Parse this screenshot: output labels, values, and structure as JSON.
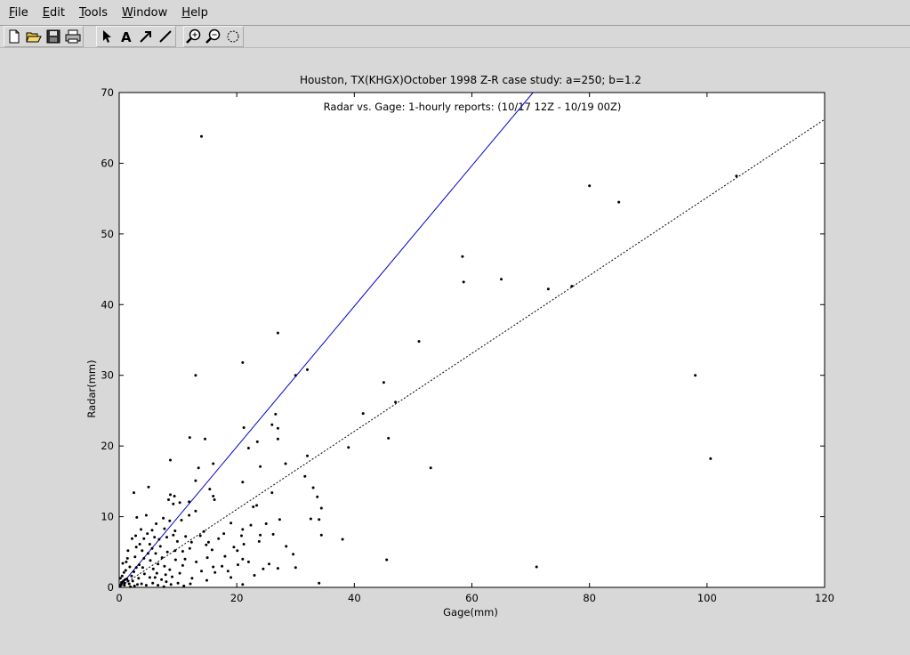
{
  "menu": [
    {
      "label": "File",
      "underline": "F",
      "rest": "ile"
    },
    {
      "label": "Edit",
      "underline": "E",
      "rest": "dit"
    },
    {
      "label": "Tools",
      "underline": "T",
      "rest": "ools"
    },
    {
      "label": "Window",
      "underline": "W",
      "rest": "indow"
    },
    {
      "label": "Help",
      "underline": "H",
      "rest": "elp"
    }
  ],
  "toolbar": {
    "file_group": [
      "new-file-icon",
      "open-folder-icon",
      "save-disk-icon",
      "print-icon"
    ],
    "edit_group": [
      "select-arrow-icon",
      "text-tool-icon",
      "arrow-tool-icon",
      "line-tool-icon"
    ],
    "view_group": [
      "zoom-in-icon",
      "zoom-out-icon",
      "rotate-icon"
    ]
  },
  "chart_data": {
    "type": "scatter",
    "title": "Houston, TX(KHGX)October 1998 Z-R case study: a=250; b=1.2",
    "subtitle": "Radar vs. Gage: 1-hourly reports: (10/17 12Z - 10/19 00Z)",
    "xlabel": "Gage(mm)",
    "ylabel": "Radar(mm)",
    "xlim": [
      0,
      120
    ],
    "ylim": [
      0,
      70
    ],
    "xticks": [
      0,
      20,
      40,
      60,
      80,
      100,
      120
    ],
    "yticks": [
      0,
      10,
      20,
      30,
      40,
      50,
      60,
      70
    ],
    "grid": false,
    "points": [
      [
        14,
        63.8
      ],
      [
        27,
        36
      ],
      [
        21,
        31.8
      ],
      [
        32,
        30.8
      ],
      [
        13,
        30
      ],
      [
        30,
        30
      ],
      [
        80,
        56.8
      ],
      [
        85,
        54.5
      ],
      [
        105,
        58.2
      ],
      [
        58.4,
        46.8
      ],
      [
        58.6,
        43.2
      ],
      [
        65,
        43.6
      ],
      [
        73,
        42.2
      ],
      [
        77,
        42.6
      ],
      [
        51,
        34.8
      ],
      [
        45,
        29
      ],
      [
        47,
        26.2
      ],
      [
        41.5,
        24.6
      ],
      [
        45.8,
        21.1
      ],
      [
        53,
        16.9
      ],
      [
        39,
        19.8
      ],
      [
        98,
        30
      ],
      [
        100.6,
        18.2
      ],
      [
        71,
        2.9
      ],
      [
        45.5,
        3.9
      ],
      [
        38,
        6.8
      ],
      [
        34,
        0.6
      ],
      [
        21.2,
        22.6
      ],
      [
        26.6,
        24.5
      ],
      [
        27,
        22.5
      ],
      [
        26,
        23
      ],
      [
        27,
        21
      ],
      [
        23.5,
        20.6
      ],
      [
        22,
        19.7
      ],
      [
        28.3,
        17.5
      ],
      [
        32,
        18.6
      ],
      [
        24,
        17.1
      ],
      [
        12,
        21.2
      ],
      [
        14.6,
        21
      ],
      [
        8.7,
        18
      ],
      [
        16,
        17.5
      ],
      [
        13.5,
        16.9
      ],
      [
        31.6,
        15.7
      ],
      [
        33,
        14.1
      ],
      [
        21,
        14.9
      ],
      [
        26,
        13.4
      ],
      [
        33.7,
        12.8
      ],
      [
        34.4,
        11.2
      ],
      [
        15.4,
        13.9
      ],
      [
        16,
        12.9
      ],
      [
        16.2,
        12.4
      ],
      [
        13,
        15.1
      ],
      [
        10.3,
        12
      ],
      [
        11.9,
        12.1
      ],
      [
        8.7,
        13.1
      ],
      [
        9.4,
        12.9
      ],
      [
        8.4,
        12.4
      ],
      [
        5,
        14.2
      ],
      [
        2.5,
        13.4
      ],
      [
        9.2,
        11.8
      ],
      [
        13,
        10.8
      ],
      [
        11.9,
        10.2
      ],
      [
        23.4,
        11.6
      ],
      [
        22.8,
        11.4
      ],
      [
        32.6,
        9.7
      ],
      [
        34,
        9.6
      ],
      [
        27.3,
        9.6
      ],
      [
        22.4,
        8.8
      ],
      [
        21,
        8.2
      ],
      [
        19,
        9.1
      ],
      [
        25,
        9
      ],
      [
        34.4,
        7.4
      ],
      [
        28.4,
        5.8
      ],
      [
        29.6,
        4.7
      ],
      [
        30,
        2.8
      ],
      [
        22,
        3.6
      ],
      [
        21,
        4
      ],
      [
        18,
        4.4
      ],
      [
        15,
        4.2
      ],
      [
        24.5,
        2.6
      ],
      [
        27,
        2.7
      ],
      [
        20.2,
        3.2
      ],
      [
        17.5,
        3
      ],
      [
        16,
        2.9
      ],
      [
        14,
        2.3
      ],
      [
        21,
        0.4
      ],
      [
        19,
        1.4
      ],
      [
        21.2,
        6.1
      ],
      [
        19.5,
        5.7
      ],
      [
        20.8,
        7.3
      ],
      [
        23.8,
        6.5
      ],
      [
        24,
        7.4
      ],
      [
        26.2,
        7.5
      ],
      [
        17.8,
        7.6
      ],
      [
        16.9,
        6.9
      ],
      [
        15.2,
        6.4
      ],
      [
        14.4,
        7.9
      ],
      [
        14.8,
        6
      ],
      [
        13.8,
        7.3
      ],
      [
        12,
        5.5
      ],
      [
        12.3,
        6.4
      ],
      [
        11.2,
        4
      ],
      [
        10.8,
        3.1
      ],
      [
        12.4,
        1.3
      ],
      [
        14.9,
        1
      ],
      [
        16.3,
        2.1
      ],
      [
        10,
        0.6
      ],
      [
        11,
        0.2
      ],
      [
        12.1,
        0.5
      ],
      [
        7.5,
        9.8
      ],
      [
        6.3,
        9
      ],
      [
        5.6,
        8.1
      ],
      [
        4.8,
        7.6
      ],
      [
        4.6,
        10.2
      ],
      [
        3.7,
        8.2
      ],
      [
        4.2,
        6.9
      ],
      [
        7.7,
        8.3
      ],
      [
        9.5,
        8
      ],
      [
        8.1,
        7.1
      ],
      [
        9.2,
        7.4
      ],
      [
        6.8,
        6.8
      ],
      [
        5.2,
        6.1
      ],
      [
        5.6,
        5.5
      ],
      [
        3.5,
        6.1
      ],
      [
        2.9,
        5.7
      ],
      [
        6.2,
        4.8
      ],
      [
        7.3,
        4.2
      ],
      [
        8.2,
        5
      ],
      [
        9.5,
        5.2
      ],
      [
        10.8,
        5.1
      ],
      [
        9.6,
        3.9
      ],
      [
        8.6,
        2.5
      ],
      [
        7.7,
        3
      ],
      [
        6.6,
        3.3
      ],
      [
        5.3,
        3.8
      ],
      [
        4.2,
        4.1
      ],
      [
        3.4,
        3.2
      ],
      [
        2.7,
        4.3
      ],
      [
        2.5,
        2.2
      ],
      [
        1.8,
        2.9
      ],
      [
        1.2,
        3.6
      ],
      [
        0.8,
        2.1
      ],
      [
        1.3,
        1.2
      ],
      [
        2.1,
        1.6
      ],
      [
        3.3,
        1.3
      ],
      [
        4.3,
        1.9
      ],
      [
        5.2,
        1.4
      ],
      [
        6.4,
        2
      ],
      [
        7.2,
        1.1
      ],
      [
        8,
        0.8
      ],
      [
        9,
        1.5
      ],
      [
        0.4,
        0.7
      ],
      [
        0.9,
        0.3
      ],
      [
        1.7,
        0.5
      ],
      [
        2.6,
        0.2
      ],
      [
        3.8,
        0.5
      ],
      [
        4.6,
        0.3
      ],
      [
        5.7,
        0.6
      ],
      [
        6.6,
        0.3
      ],
      [
        7.6,
        0.1
      ],
      [
        8.8,
        0.4
      ],
      [
        0.2,
        0.2
      ],
      [
        1,
        1.1
      ],
      [
        0.5,
        1.6
      ],
      [
        1.5,
        0.9
      ],
      [
        2.3,
        0.9
      ],
      [
        3.1,
        0.4
      ],
      [
        0.3,
        0.4
      ],
      [
        0.7,
        0.9
      ],
      [
        1.9,
        0.1
      ],
      [
        4,
        2.8
      ],
      [
        5.8,
        2.6
      ],
      [
        6,
        7.1
      ],
      [
        7,
        5.8
      ],
      [
        3,
        9.9
      ],
      [
        2.2,
        6.9
      ],
      [
        1.5,
        5.2
      ],
      [
        0.6,
        3.4
      ],
      [
        10.3,
        2
      ],
      [
        13.1,
        3.6
      ],
      [
        15.8,
        5.3
      ],
      [
        18.5,
        2.3
      ],
      [
        20.1,
        5.2
      ],
      [
        25.5,
        3.3
      ],
      [
        23,
        1.7
      ],
      [
        10.6,
        9.5
      ],
      [
        11.3,
        7.2
      ],
      [
        9.9,
        6.5
      ],
      [
        8.6,
        9.4
      ],
      [
        3.9,
        5.2
      ],
      [
        2.8,
        7.3
      ],
      [
        1.1,
        2.4
      ],
      [
        0.2,
        1.3
      ],
      [
        2.9,
        2.8
      ],
      [
        4.9,
        4.8
      ],
      [
        7.9,
        1.8
      ],
      [
        6.1,
        1.4
      ],
      [
        1.4,
        4.1
      ],
      [
        0.9,
        0.6
      ]
    ],
    "lines": [
      {
        "style": "solid",
        "color": "#0000cc",
        "x": [
          0,
          70.4
        ],
        "y": [
          0,
          70
        ]
      },
      {
        "style": "dotted",
        "color": "#000000",
        "x": [
          0,
          120
        ],
        "y": [
          0,
          66.2
        ]
      }
    ]
  }
}
